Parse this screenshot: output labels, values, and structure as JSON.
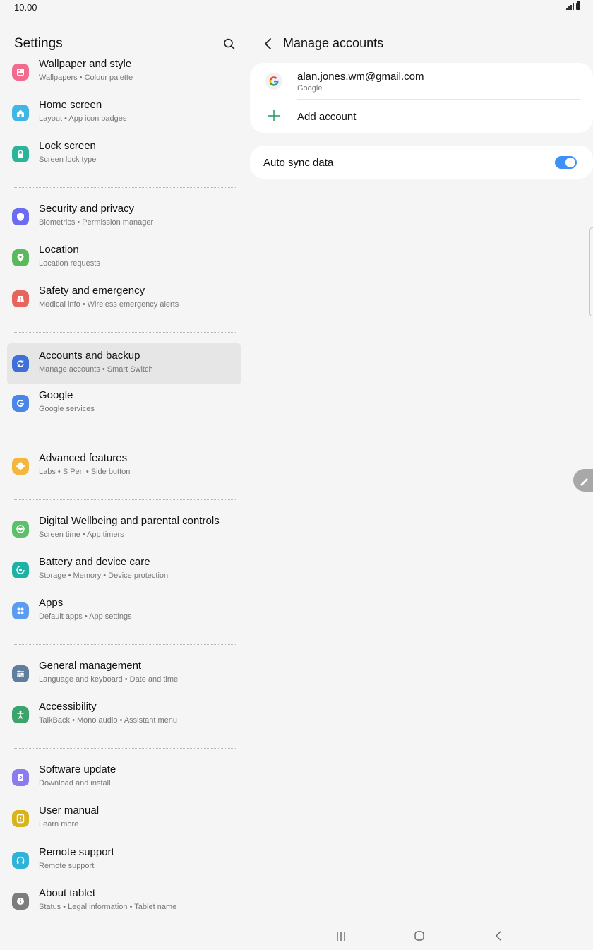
{
  "status_bar": {
    "time": "10.00"
  },
  "left_pane": {
    "title": "Settings",
    "groups": [
      [
        {
          "id": "wallpaper",
          "title": "Wallpaper and style",
          "subtitle": "Wallpapers  •  Colour palette",
          "icon": "wallpaper-icon",
          "color": "#f06b8e"
        },
        {
          "id": "home",
          "title": "Home screen",
          "subtitle": "Layout  •  App icon badges",
          "icon": "home-icon",
          "color": "#3fb6e3"
        },
        {
          "id": "lock",
          "title": "Lock screen",
          "subtitle": "Screen lock type",
          "icon": "lock-icon",
          "color": "#2bb49a"
        }
      ],
      [
        {
          "id": "security",
          "title": "Security and privacy",
          "subtitle": "Biometrics  •  Permission manager",
          "icon": "shield-icon",
          "color": "#6b6cf0"
        },
        {
          "id": "location",
          "title": "Location",
          "subtitle": "Location requests",
          "icon": "location-pin-icon",
          "color": "#5cb85c"
        },
        {
          "id": "safety",
          "title": "Safety and emergency",
          "subtitle": "Medical info  •  Wireless emergency alerts",
          "icon": "alert-icon",
          "color": "#e8655e"
        }
      ],
      [
        {
          "id": "accounts",
          "title": "Accounts and backup",
          "subtitle": "Manage accounts  •  Smart Switch",
          "icon": "sync-icon",
          "color": "#3f6fd8",
          "selected": true
        },
        {
          "id": "google",
          "title": "Google",
          "subtitle": "Google services",
          "icon": "google-g-icon",
          "color": "#4a86e8"
        }
      ],
      [
        {
          "id": "advanced",
          "title": "Advanced features",
          "subtitle": "Labs  •  S Pen  •  Side button",
          "icon": "gear-plus-icon",
          "color": "#f4b73c"
        }
      ],
      [
        {
          "id": "wellbeing",
          "title": "Digital Wellbeing and parental controls",
          "subtitle": "Screen time  •  App timers",
          "icon": "heart-circle-icon",
          "color": "#5cc06a"
        },
        {
          "id": "battery",
          "title": "Battery and device care",
          "subtitle": "Storage  •  Memory  •  Device protection",
          "icon": "device-care-icon",
          "color": "#1bb3a4"
        },
        {
          "id": "apps",
          "title": "Apps",
          "subtitle": "Default apps  •  App settings",
          "icon": "apps-grid-icon",
          "color": "#5a9cf0"
        }
      ],
      [
        {
          "id": "general",
          "title": "General management",
          "subtitle": "Language and keyboard  •  Date and time",
          "icon": "sliders-icon",
          "color": "#5f7d9c"
        },
        {
          "id": "accessibility",
          "title": "Accessibility",
          "subtitle": "TalkBack  •  Mono audio  •  Assistant menu",
          "icon": "accessibility-icon",
          "color": "#3aa46a"
        }
      ],
      [
        {
          "id": "software",
          "title": "Software update",
          "subtitle": "Download and install",
          "icon": "update-icon",
          "color": "#8a7cf0"
        },
        {
          "id": "manual",
          "title": "User manual",
          "subtitle": "Learn more",
          "icon": "manual-icon",
          "color": "#d8b31a"
        },
        {
          "id": "remote",
          "title": "Remote support",
          "subtitle": "Remote support",
          "icon": "headset-icon",
          "color": "#2fb3d9"
        },
        {
          "id": "about",
          "title": "About tablet",
          "subtitle": "Status  •  Legal information  •  Tablet name",
          "icon": "info-icon",
          "color": "#7d7d7d"
        }
      ]
    ]
  },
  "right_pane": {
    "title": "Manage accounts",
    "account": {
      "email": "alan.jones.wm@gmail.com",
      "type": "Google"
    },
    "add_account_label": "Add account",
    "auto_sync": {
      "label": "Auto sync data",
      "enabled": true
    }
  },
  "colors": {
    "background": "#f5f5f5",
    "card": "#ffffff",
    "toggle_on": "#3e91f7",
    "add_icon": "#2e9c6b",
    "selected_row": "#e6e6e6"
  }
}
